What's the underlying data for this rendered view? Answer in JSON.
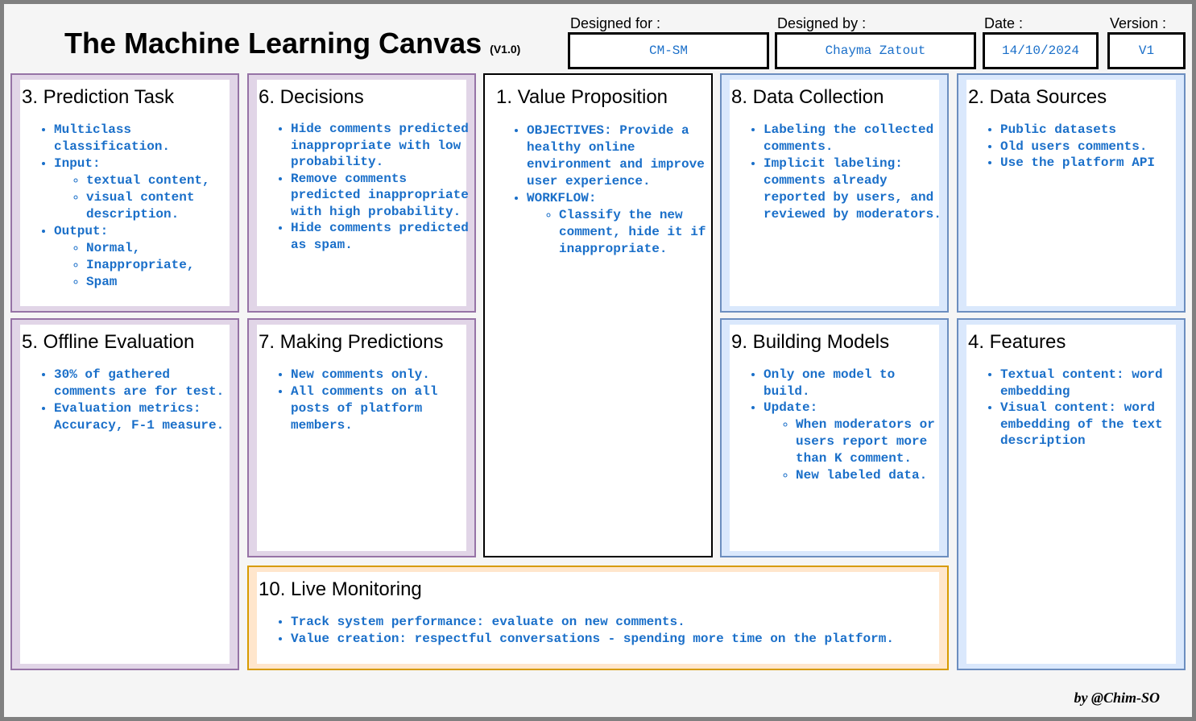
{
  "header": {
    "title": "The Machine Learning Canvas",
    "version_tag": "(V1.0)",
    "designed_for_label": "Designed for :",
    "designed_for_value": "CM-SM",
    "designed_by_label": "Designed by :",
    "designed_by_value": "Chayma Zatout",
    "date_label": "Date :",
    "date_value": "14/10/2024",
    "version_label": "Version :",
    "version_value": "V1"
  },
  "cards": {
    "prediction_task": {
      "title": "3. Prediction Task",
      "items": [
        "Multiclass classification.",
        "Input:",
        "Output:"
      ],
      "input_sub": [
        "textual content,",
        "visual content description."
      ],
      "output_sub": [
        "Normal,",
        "Inappropriate,",
        "Spam"
      ]
    },
    "decisions": {
      "title": "6. Decisions",
      "items": [
        "Hide comments predicted inappropriate with low probability.",
        "Remove comments predicted inappropriate with high probability.",
        "Hide comments predicted as spam."
      ]
    },
    "value_proposition": {
      "title": "1. Value Proposition",
      "items": [
        "OBJECTIVES: Provide a healthy online environment and improve user experience.",
        "WORKFLOW:"
      ],
      "workflow_sub": [
        "Classify the new comment, hide it if inappropriate."
      ]
    },
    "data_collection": {
      "title": "8. Data Collection",
      "items": [
        "Labeling the collected comments.",
        "Implicit labeling: comments already reported by users, and reviewed by moderators."
      ]
    },
    "data_sources": {
      "title": "2. Data Sources",
      "items": [
        "Public datasets",
        "Old users comments.",
        "Use the platform API"
      ]
    },
    "offline_evaluation": {
      "title": "5. Offline Evaluation",
      "items": [
        "30% of gathered comments are for test.",
        "Evaluation metrics: Accuracy, F-1 measure."
      ]
    },
    "making_predictions": {
      "title": "7. Making Predictions",
      "items": [
        "New comments only.",
        "All comments on all posts of platform members."
      ]
    },
    "building_models": {
      "title": "9. Building Models",
      "items": [
        "Only one model to build.",
        "Update:"
      ],
      "update_sub": [
        "When moderators or users report more than K comment.",
        "New labeled data."
      ]
    },
    "features": {
      "title": "4. Features",
      "items": [
        "Textual content: word embedding",
        "Visual content: word embedding of the text description"
      ]
    },
    "live_monitoring": {
      "title": "10. Live Monitoring",
      "items": [
        "Track system performance: evaluate on new comments.",
        "Value creation: respectful conversations - spending more time on the platform."
      ]
    }
  },
  "footer": {
    "credit": "by @Chim-SO"
  },
  "colors": {
    "purple_fill": "#e1d5e7",
    "purple_border": "#9673a6",
    "blue_fill": "#dae8fc",
    "blue_border": "#6c8ebf",
    "orange_fill": "#ffe6cc",
    "orange_border": "#d79b00",
    "text_accent": "#1a6fc9"
  }
}
